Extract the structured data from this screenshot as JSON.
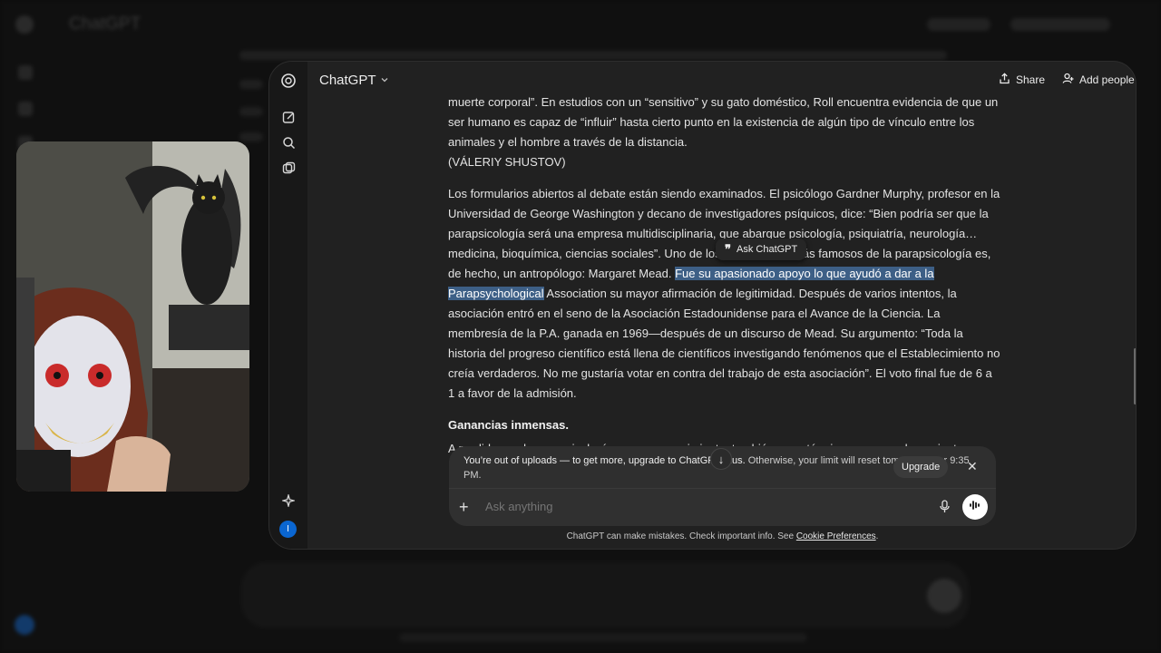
{
  "app": {
    "title": "ChatGPT"
  },
  "topbar": {
    "model": "ChatGPT",
    "share": "Share",
    "add_people": "Add people",
    "more": "···"
  },
  "rail": {
    "avatar_letter": "I"
  },
  "message": {
    "p1_line1": "muerte corporal”. En estudios con un “sensitivo” y su gato doméstico, Roll encuentra evidencia de que un ser humano es capaz de “influir” hasta cierto punto en la existencia de algún tipo de vínculo entre los animales y el hombre a través de la distancia.",
    "p1_author": "(VÁLERIY SHUSTOV)",
    "p2_pre": "Los formularios abiertos al debate están siendo examinados. El psicólogo Gardner Murphy, profesor en la Universidad de George Washington y decano de investigadores psíquicos, dice: “Bien podría ser que la parapsicología será una empresa multidisciplinaria, que abarque psicología, psiquiatría, neurología… medicina, bioquímica, ciencias sociales”. Uno de los proponentes más famosos de la parapsicología es, de hecho, un antropólogo: Margaret Mead. ",
    "p2_highlight": "Fue su apasionado apoyo lo que ayudó a dar a la Parapsychological",
    "p2_post": " Association su mayor afirmación de legitimidad. Después de varios intentos, la asociación entró en el seno de la Asociación Estadounidense para el Avance de la Ciencia. La membresía de la P.A. ganada en 1969—después de un discurso de Mead. Su argumento: “Toda la historia del progreso científico está llena de científicos investigando fenómenos que el Establecimiento no creía verdaderos. No me gustaría votar en contra del trabajo de esta asociación”. El voto final fue de 6 a 1 a favor de la admisión.",
    "heading": "Ganancias inmensas.",
    "p3_partial": "A medida que la parapsicología gana reconocimiento, también gana términos en moneda corriente:"
  },
  "ask_chip": {
    "label": "Ask ChatGPT"
  },
  "notice": {
    "strong": "You’re out of uploads — to get more, upgrade to ChatGPT Plus.",
    "rest": " Otherwise, your limit will reset tomorrow after 9:35 PM.",
    "upgrade": "Upgrade"
  },
  "composer": {
    "placeholder": "Ask anything"
  },
  "footer": {
    "text": "ChatGPT can make mistakes. Check important info. See ",
    "link": "Cookie Preferences",
    "end": "."
  }
}
